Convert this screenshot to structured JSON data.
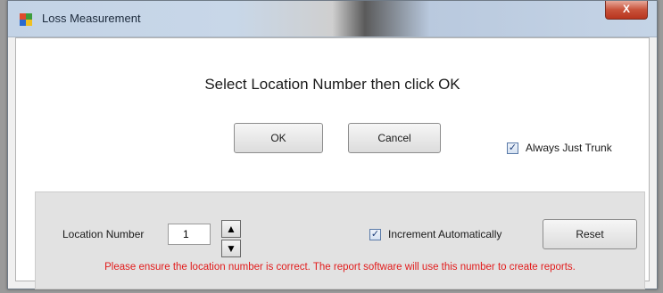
{
  "window": {
    "title": "Loss Measurement",
    "close_glyph": "X"
  },
  "dialog": {
    "prompt": "Select Location Number then click OK",
    "ok_label": "OK",
    "cancel_label": "Cancel",
    "always_just_trunk": {
      "label": "Always Just Trunk",
      "checked": true
    }
  },
  "location": {
    "label": "Location Number",
    "value": "1",
    "increment_auto": {
      "label": "Increment Automatically",
      "checked": true
    },
    "reset_label": "Reset",
    "warning": "Please ensure the location number is correct.  The report software will use this number to create reports."
  },
  "colors": {
    "warning_text": "#e21b1b",
    "close_button": "#c8523a"
  }
}
